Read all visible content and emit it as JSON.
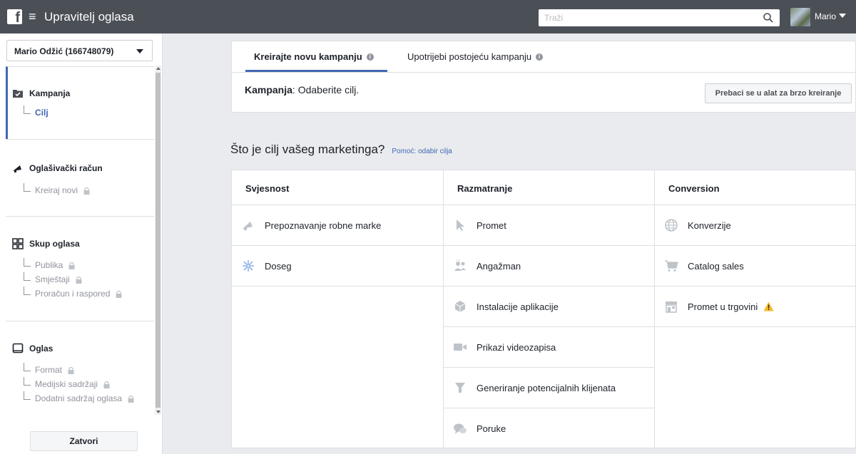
{
  "topbar": {
    "logo": "f",
    "menu_glyph": "≡",
    "title": "Upravitelj oglasa",
    "search_placeholder": "Traži",
    "user_name": "Mario"
  },
  "sidebar": {
    "account": "Mario Odžić (166748079)",
    "sections": [
      {
        "title": "Kampanja",
        "icon": "folder-check-icon",
        "items": [
          {
            "label": "Cilj",
            "locked": false,
            "current": true
          }
        ]
      },
      {
        "title": "Oglašivački račun",
        "icon": "megaphone-icon",
        "items": [
          {
            "label": "Kreiraj novi",
            "locked": true
          }
        ]
      },
      {
        "title": "Skup oglasa",
        "icon": "grid-icon",
        "items": [
          {
            "label": "Publika",
            "locked": true
          },
          {
            "label": "Smještaji",
            "locked": true
          },
          {
            "label": "Proračun i raspored",
            "locked": true
          }
        ]
      },
      {
        "title": "Oglas",
        "icon": "monitor-icon",
        "items": [
          {
            "label": "Format",
            "locked": true
          },
          {
            "label": "Medijski sadržaji",
            "locked": true
          },
          {
            "label": "Dodatni sadržaj oglasa",
            "locked": true
          }
        ]
      }
    ],
    "close_label": "Zatvori"
  },
  "campaign": {
    "tabs": [
      {
        "label": "Kreirajte novu kampanju",
        "active": true
      },
      {
        "label": "Upotrijebi postojeću kampanju",
        "active": false
      }
    ],
    "label_bold": "Kampanja",
    "label_rest": ": Odaberite cilj.",
    "quick_button": "Prebaci se u alat za brzo kreiranje"
  },
  "question": {
    "text": "Što je cilj vašeg marketinga?",
    "help": "Pomoć: odabir cilja"
  },
  "objectives": {
    "columns": [
      {
        "header": "Svjesnost",
        "items": [
          {
            "label": "Prepoznavanje robne marke",
            "icon": "megaphone-icon"
          },
          {
            "label": "Doseg",
            "icon": "reach-icon"
          }
        ]
      },
      {
        "header": "Razmatranje",
        "items": [
          {
            "label": "Promet",
            "icon": "cursor-icon"
          },
          {
            "label": "Angažman",
            "icon": "people-icon"
          },
          {
            "label": "Instalacije aplikacije",
            "icon": "cube-icon"
          },
          {
            "label": "Prikazi videozapisa",
            "icon": "video-icon"
          },
          {
            "label": "Generiranje potencijalnih klijenata",
            "icon": "funnel-icon"
          },
          {
            "label": "Poruke",
            "icon": "chat-icon"
          }
        ]
      },
      {
        "header": "Conversion",
        "items": [
          {
            "label": "Konverzije",
            "icon": "globe-icon"
          },
          {
            "label": "Catalog sales",
            "icon": "cart-icon"
          },
          {
            "label": "Promet u trgovini",
            "icon": "store-icon",
            "warning": true
          }
        ]
      }
    ]
  },
  "colors": {
    "topbar": "#4b4f56",
    "accent": "#4267b2",
    "warning": "#f7b928"
  }
}
